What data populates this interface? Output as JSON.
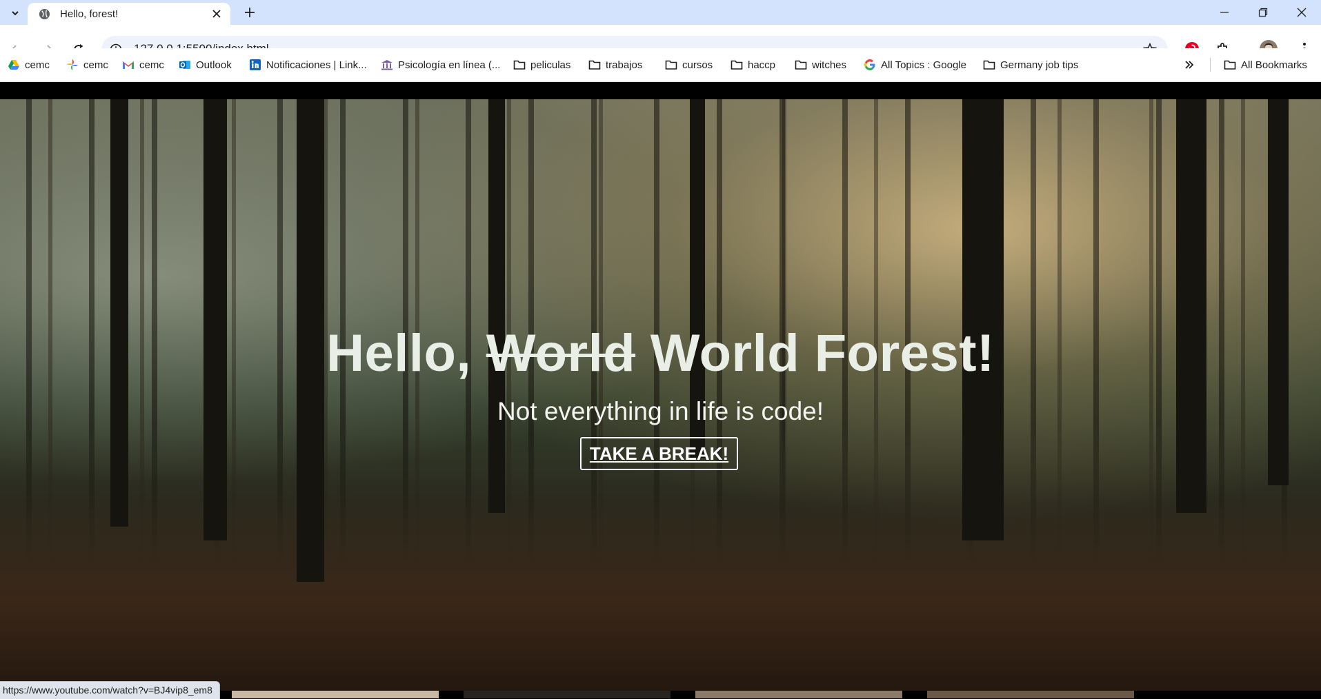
{
  "browser": {
    "tab_title": "Hello, forest!",
    "url": "127.0.0.1:5500/index.html",
    "status_url": "https://www.youtube.com/watch?v=BJ4vip8_em8"
  },
  "bookmarks": {
    "items": [
      {
        "label": "cemc",
        "icon": "google-drive-icon"
      },
      {
        "label": "cemc",
        "icon": "google-photos-icon"
      },
      {
        "label": "cemc",
        "icon": "gmail-icon"
      },
      {
        "label": "Outlook",
        "icon": "outlook-icon"
      },
      {
        "label": "Notificaciones | Link...",
        "icon": "linkedin-icon"
      },
      {
        "label": "Psicología en línea (...",
        "icon": "university-icon"
      },
      {
        "label": "peliculas",
        "icon": "folder-icon"
      },
      {
        "label": "trabajos",
        "icon": "folder-icon"
      },
      {
        "label": "cursos",
        "icon": "folder-icon"
      },
      {
        "label": "haccp",
        "icon": "folder-icon"
      },
      {
        "label": "witches",
        "icon": "folder-icon"
      },
      {
        "label": "All Topics : Google",
        "icon": "google-icon"
      },
      {
        "label": "Germany job tips",
        "icon": "folder-icon"
      }
    ],
    "all_bookmarks": "All Bookmarks"
  },
  "hero": {
    "title_start": "Hello,",
    "title_struck": "World",
    "title_end": "World Forest!",
    "subtitle": "Not everything in life is code!",
    "cta_label": "TAKE A BREAK!"
  },
  "colors": {
    "tabstrip": "#d3e3fd",
    "title_text": "#e9efe6",
    "pinterest": "#e60023"
  }
}
